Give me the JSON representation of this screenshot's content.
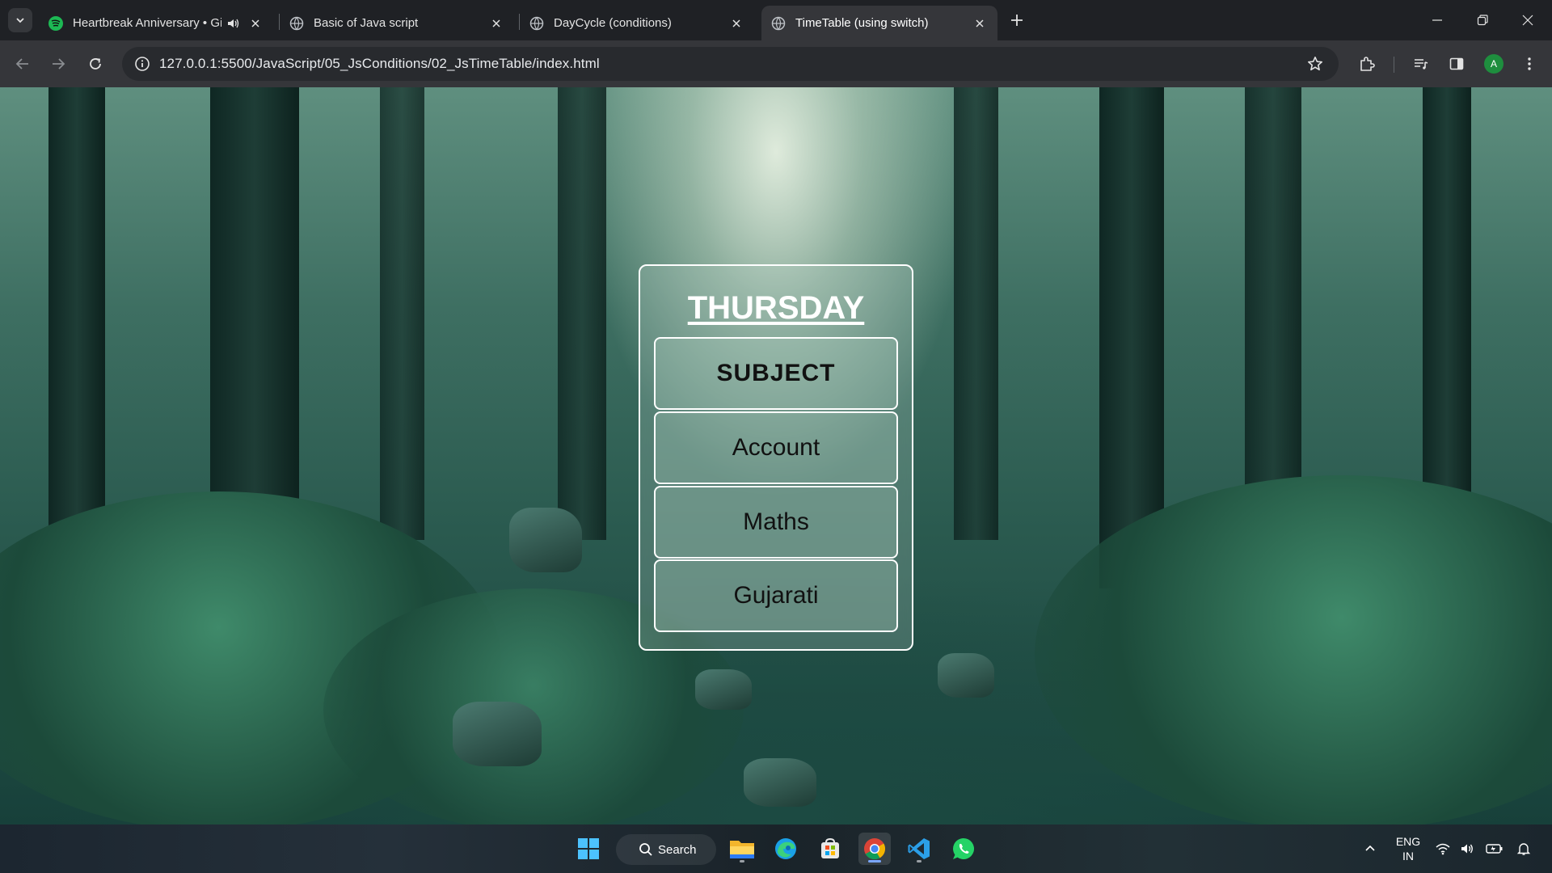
{
  "browser": {
    "tabs": [
      {
        "title": "Heartbreak Anniversary • Gi",
        "favicon": "spotify-icon",
        "audio": true,
        "active": false
      },
      {
        "title": "Basic of Java script",
        "favicon": "globe-icon",
        "active": false
      },
      {
        "title": "DayCycle (conditions)",
        "favicon": "globe-icon",
        "active": false
      },
      {
        "title": "TimeTable (using switch)",
        "favicon": "globe-icon",
        "active": true
      }
    ],
    "url": "127.0.0.1:5500/JavaScript/05_JsConditions/02_JsTimeTable/index.html",
    "profile_initial": "A"
  },
  "page": {
    "day": "THURSDAY",
    "header": "SUBJECT",
    "subjects": [
      "Account",
      "Maths",
      "Gujarati"
    ]
  },
  "taskbar": {
    "search_label": "Search",
    "language_line1": "ENG",
    "language_line2": "IN",
    "apps": [
      "windows-start",
      "search",
      "file-explorer",
      "edge",
      "microsoft-store",
      "chrome",
      "vscode",
      "whatsapp"
    ]
  },
  "colors": {
    "accent_green": "#1db954",
    "chrome_bg": "#1f2125",
    "toolbar_bg": "#35363a",
    "card_border": "#ffffff"
  }
}
